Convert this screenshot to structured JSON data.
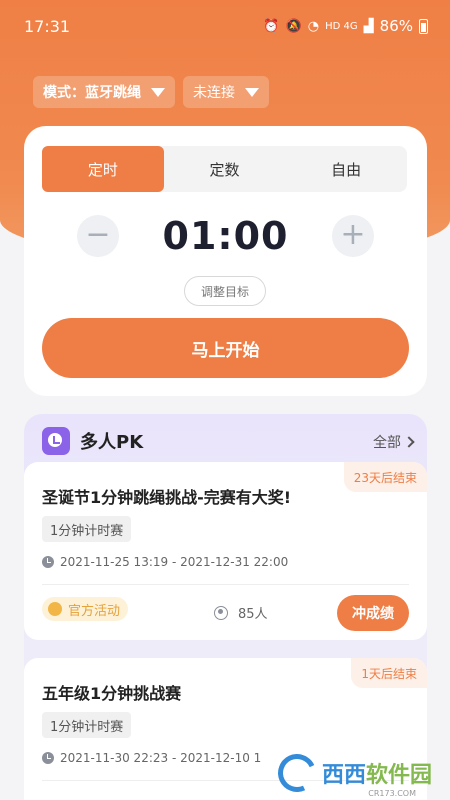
{
  "status_bar": {
    "time": "17:31",
    "network": "HD 4G",
    "battery": "86%"
  },
  "header": {
    "mode_select": "模式：蓝牙跳绳",
    "connection_select": "未连接"
  },
  "timer": {
    "tabs": [
      "定时",
      "定数",
      "自由"
    ],
    "active_tab": "定时",
    "value": "01:00",
    "minus_label": "−",
    "plus_label": "+",
    "adjust_label": "调整目标",
    "start_label": "马上开始"
  },
  "pk": {
    "title": "多人PK",
    "all_label": "全部",
    "events": [
      {
        "badge": "23天后结束",
        "title": "圣诞节1分钟跳绳挑战-完赛有大奖!",
        "tag": "1分钟计时赛",
        "date_range": "2021-11-25 13:19 - 2021-12-31 22:00",
        "official_label": "官方活动",
        "participants": "85人",
        "action_label": "冲成绩"
      },
      {
        "badge": "1天后结束",
        "title": "五年级1分钟挑战赛",
        "tag": "1分钟计时赛",
        "date_range": "2021-11-30 22:23 - 2021-12-10 1"
      }
    ]
  },
  "watermark": {
    "name_a": "西西",
    "name_b": "软件园",
    "url": "CR173.COM"
  },
  "colors": {
    "accent": "#ee7e45",
    "purple": "#8a63e8",
    "watermark_blue": "#2a86d8"
  }
}
